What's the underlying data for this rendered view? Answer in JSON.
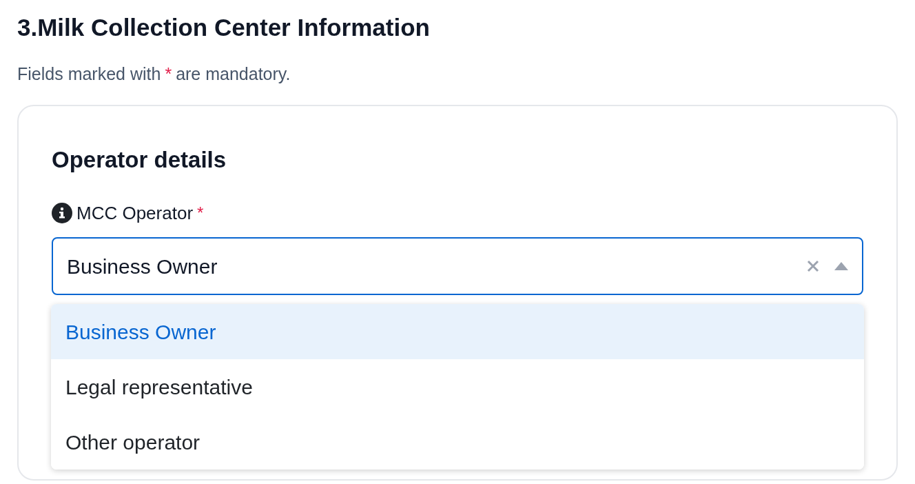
{
  "section_title": "3.Milk Collection Center Information",
  "note": {
    "before": "Fields marked with",
    "mark": "*",
    "after": "are mandatory."
  },
  "card": {
    "title": "Operator details",
    "field": {
      "label": "MCC Operator",
      "required_mark": "*",
      "value": "Business Owner",
      "expanded": true,
      "options": [
        {
          "label": "Business Owner",
          "selected": true
        },
        {
          "label": "Legal representative",
          "selected": false
        },
        {
          "label": "Other operator",
          "selected": false
        }
      ]
    }
  }
}
